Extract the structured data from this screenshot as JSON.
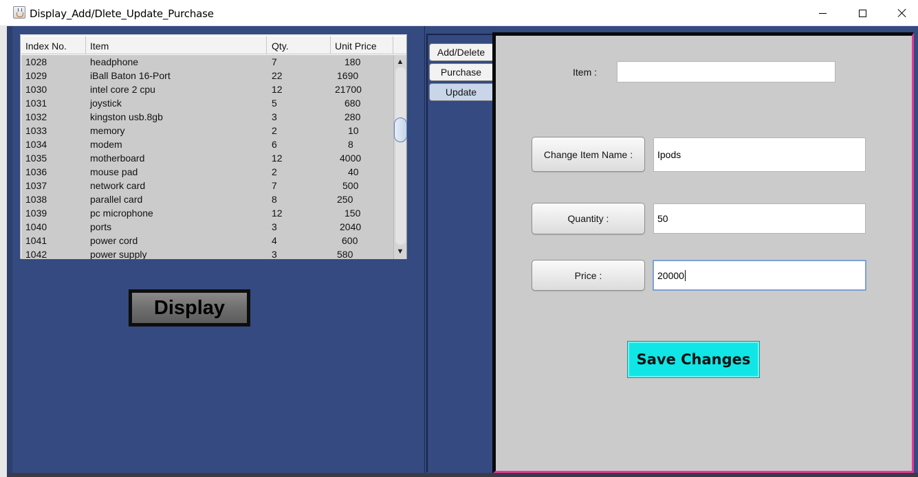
{
  "window": {
    "title": "Display_Add/Dlete_Update_Purchase",
    "icon": "java-cup-icon"
  },
  "table": {
    "columns": [
      "Index No.",
      "Item",
      "Qty.",
      "Unit Price"
    ],
    "rows": [
      [
        "1028",
        "headphone",
        "7",
        "180"
      ],
      [
        "1029",
        "iBall Baton 16-Port",
        "22",
        "1690"
      ],
      [
        "1030",
        "intel core 2 cpu",
        "12",
        "21700"
      ],
      [
        "1031",
        "joystick",
        "5",
        "680"
      ],
      [
        "1032",
        "kingston usb.8gb",
        "3",
        "280"
      ],
      [
        "1033",
        "memory",
        "2",
        "10"
      ],
      [
        "1034",
        "modem",
        "6",
        "8"
      ],
      [
        "1035",
        "motherboard",
        "12",
        "4000"
      ],
      [
        "1036",
        "mouse pad",
        "2",
        "40"
      ],
      [
        "1037",
        "network card",
        "7",
        "500"
      ],
      [
        "1038",
        "parallel card",
        "8",
        "250"
      ],
      [
        "1039",
        "pc microphone",
        "12",
        "150"
      ],
      [
        "1040",
        "ports",
        "3",
        "2040"
      ],
      [
        "1041",
        "power cord",
        "4",
        "600"
      ],
      [
        "1042",
        "power supply",
        "3",
        "580"
      ]
    ]
  },
  "display_button": "Display",
  "tabs": [
    "Add/Delete",
    "Purchase",
    "Update"
  ],
  "active_tab": "Update",
  "update_form": {
    "item_label": "Item :",
    "item_value": "",
    "change_name_label": "Change Item Name :",
    "change_name_value": "Ipods",
    "quantity_label": "Quantity :",
    "quantity_value": "50",
    "price_label": "Price :",
    "price_value": "20000",
    "save_label": "Save Changes"
  },
  "colors": {
    "panel_background": "#344a80",
    "form_background": "#cbcbcb",
    "save_button": "#11e6e6",
    "accent_border": "#e43a99"
  }
}
